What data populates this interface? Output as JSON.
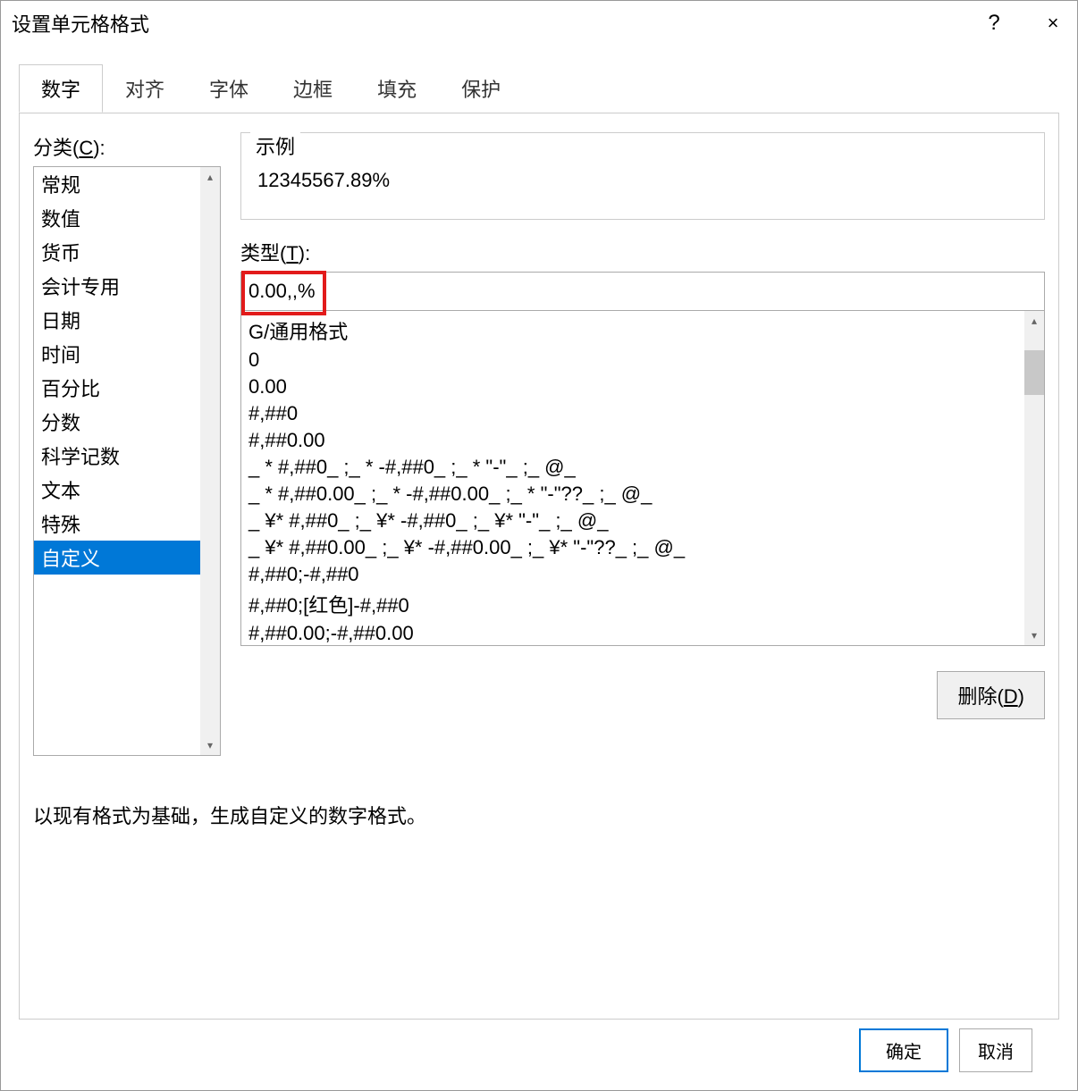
{
  "titlebar": {
    "title": "设置单元格格式",
    "help": "?",
    "close": "×"
  },
  "tabs": [
    {
      "label": "数字",
      "active": true
    },
    {
      "label": "对齐",
      "active": false
    },
    {
      "label": "字体",
      "active": false
    },
    {
      "label": "边框",
      "active": false
    },
    {
      "label": "填充",
      "active": false
    },
    {
      "label": "保护",
      "active": false
    }
  ],
  "category": {
    "label_prefix": "分类(",
    "label_underline": "C",
    "label_suffix": "):",
    "items": [
      "常规",
      "数值",
      "货币",
      "会计专用",
      "日期",
      "时间",
      "百分比",
      "分数",
      "科学记数",
      "文本",
      "特殊",
      "自定义"
    ],
    "selected_index": 11
  },
  "sample": {
    "group_label": "示例",
    "value": "12345567.89%"
  },
  "type": {
    "label_prefix": "类型(",
    "label_underline": "T",
    "label_suffix": "):",
    "input_value": "0.00,,%",
    "formats": [
      "G/通用格式",
      "0",
      "0.00",
      "#,##0",
      "#,##0.00",
      "_ * #,##0_ ;_ * -#,##0_ ;_ * \"-\"_ ;_ @_",
      "_ * #,##0.00_ ;_ * -#,##0.00_ ;_ * \"-\"??_ ;_ @_",
      "_ ¥* #,##0_ ;_ ¥* -#,##0_ ;_ ¥* \"-\"_ ;_ @_",
      "_ ¥* #,##0.00_ ;_ ¥* -#,##0.00_ ;_ ¥* \"-\"??_ ;_ @_",
      "#,##0;-#,##0",
      "#,##0;[红色]-#,##0",
      "#,##0.00;-#,##0.00"
    ]
  },
  "delete_button": {
    "label_prefix": "删除(",
    "label_underline": "D",
    "label_suffix": ")"
  },
  "help_text": "以现有格式为基础，生成自定义的数字格式。",
  "bottom": {
    "ok": "确定",
    "cancel": "取消"
  }
}
